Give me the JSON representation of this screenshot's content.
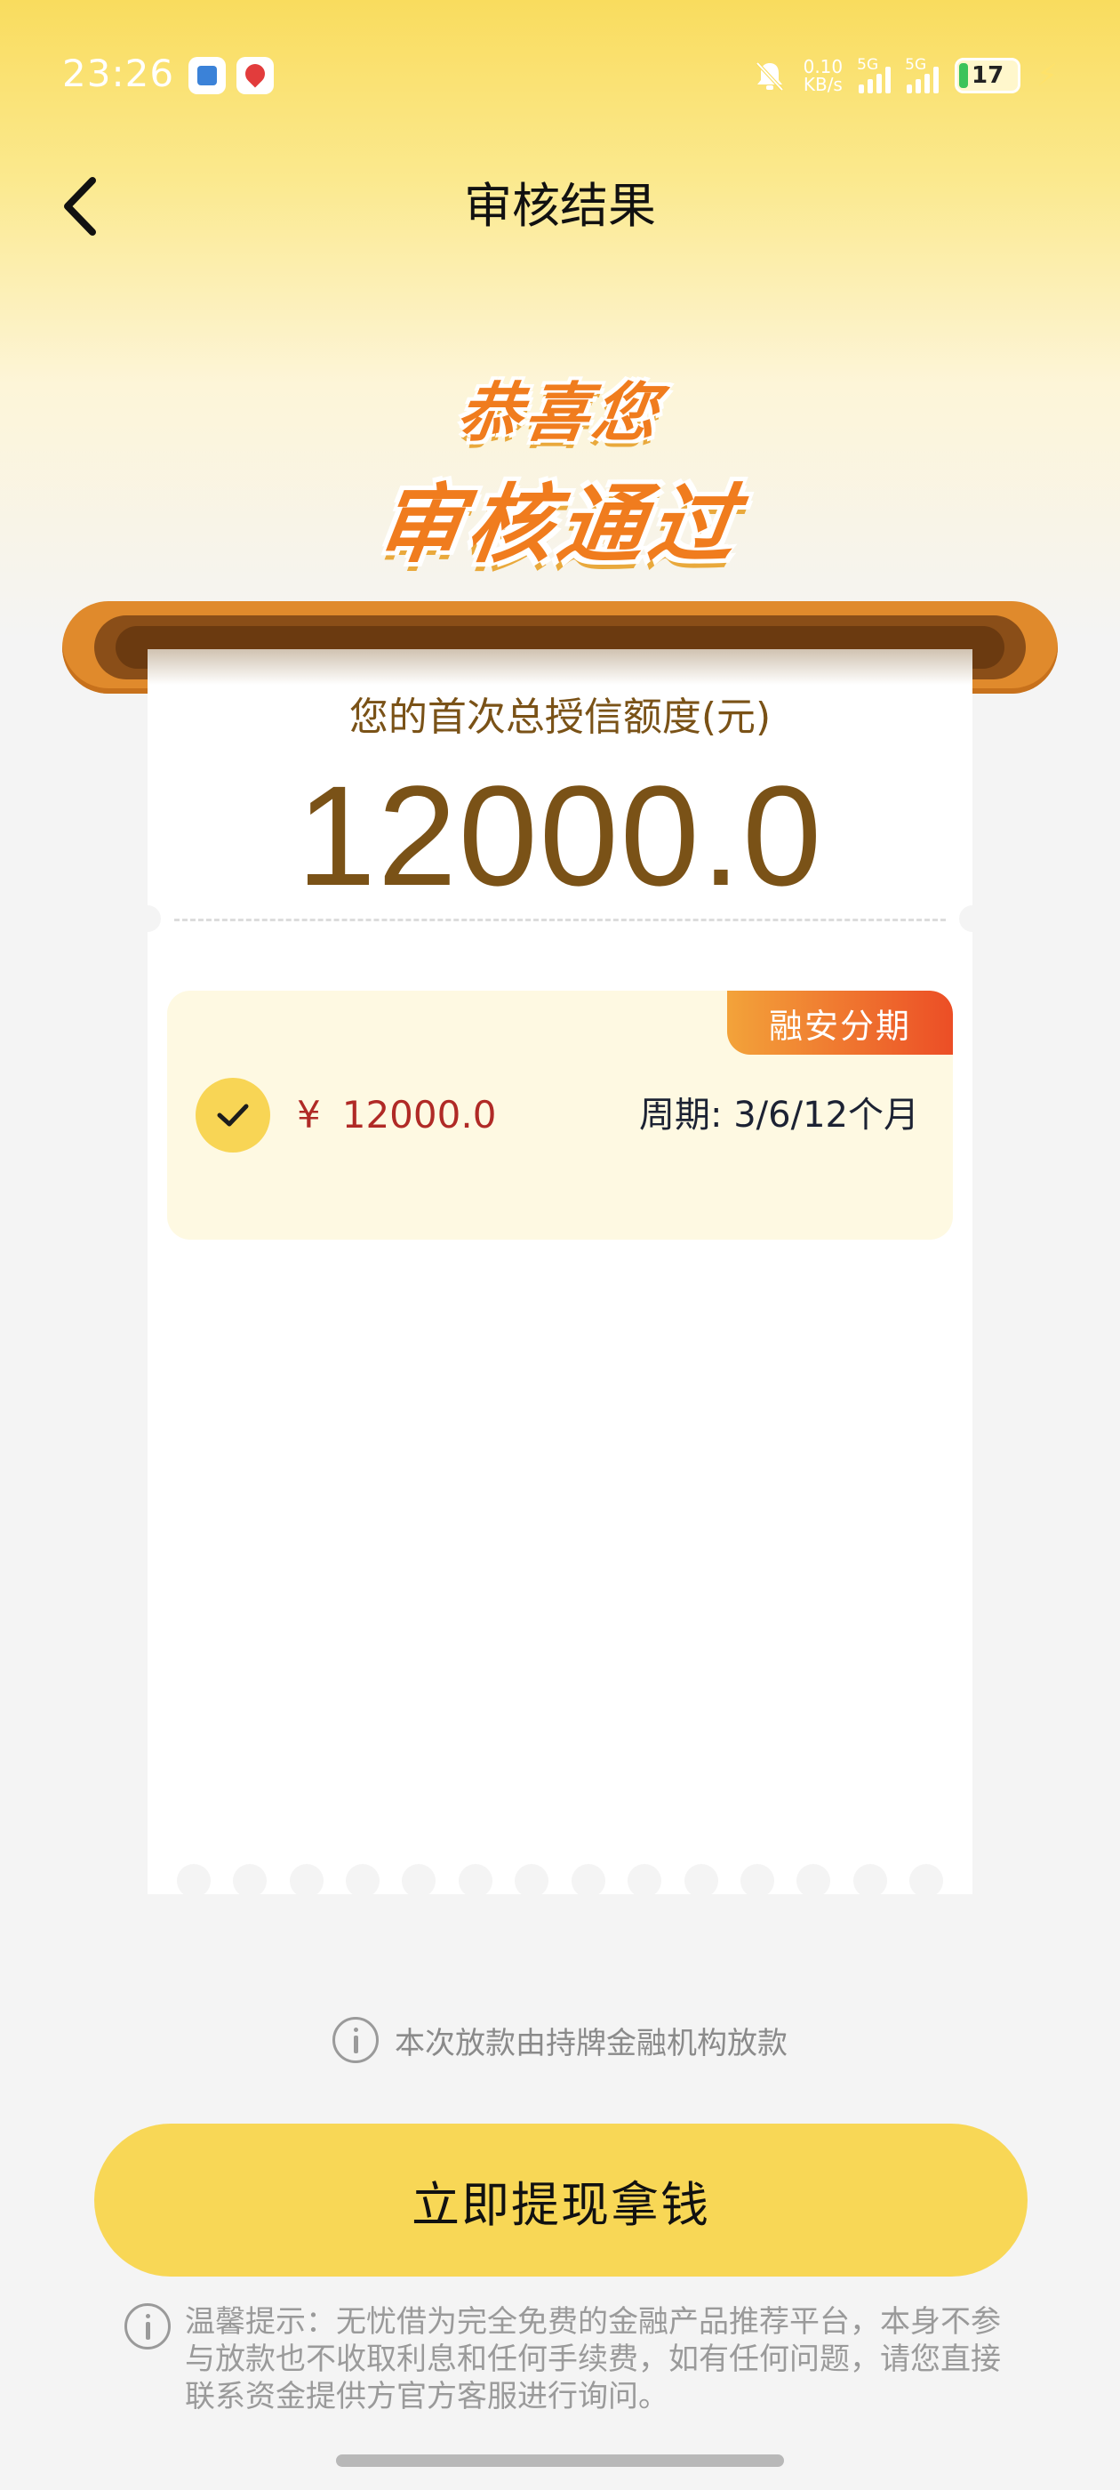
{
  "status_bar": {
    "time": "23:26",
    "net_speed_value": "0.10",
    "net_speed_unit": "KB/s",
    "sim1": "5G",
    "sim2": "5G",
    "battery": "17"
  },
  "header": {
    "title": "审核结果",
    "back_icon": "chevron-left-icon"
  },
  "hero": {
    "line1": "恭喜您",
    "line2": "审核通过"
  },
  "credit": {
    "label": "您的首次总授信额度(元)",
    "amount": "12000.0"
  },
  "loan_option": {
    "tag": "融安分期",
    "currency": "¥",
    "amount": "12000.0",
    "period": "周期: 3/6/12个月",
    "selected": true
  },
  "notice": "本次放款由持牌金融机构放款",
  "primary_button": "立即提现拿钱",
  "tip": "温馨提示：无忧借为完全免费的金融产品推荐平台，本身不参与放款也不收取利息和任何手续费，如有任何问题，请您直接联系资金提供方官方客服进行询问。",
  "colors": {
    "accent_yellow": "#f8d756",
    "amount_brown": "#7a5217",
    "tag_orange": "#ec4e26",
    "price_red": "#b02a26"
  }
}
